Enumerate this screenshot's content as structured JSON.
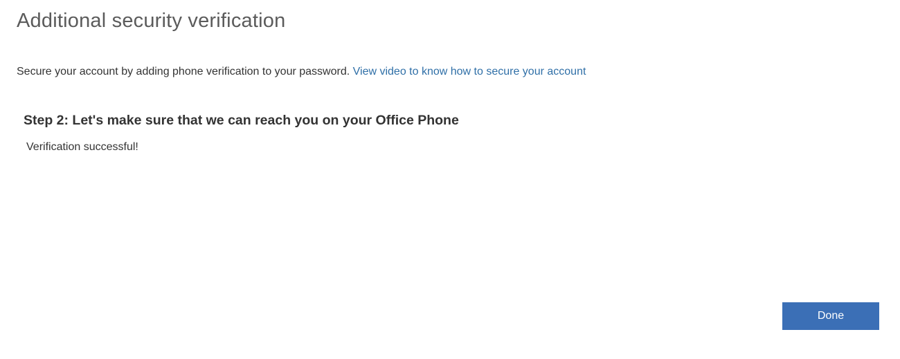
{
  "header": {
    "title": "Additional security verification"
  },
  "intro": {
    "text": "Secure your account by adding phone verification to your password. ",
    "link_text": "View video to know how to secure your account"
  },
  "step": {
    "heading": "Step 2: Let's make sure that we can reach you on your Office Phone",
    "status": "Verification successful!"
  },
  "actions": {
    "done_label": "Done"
  }
}
